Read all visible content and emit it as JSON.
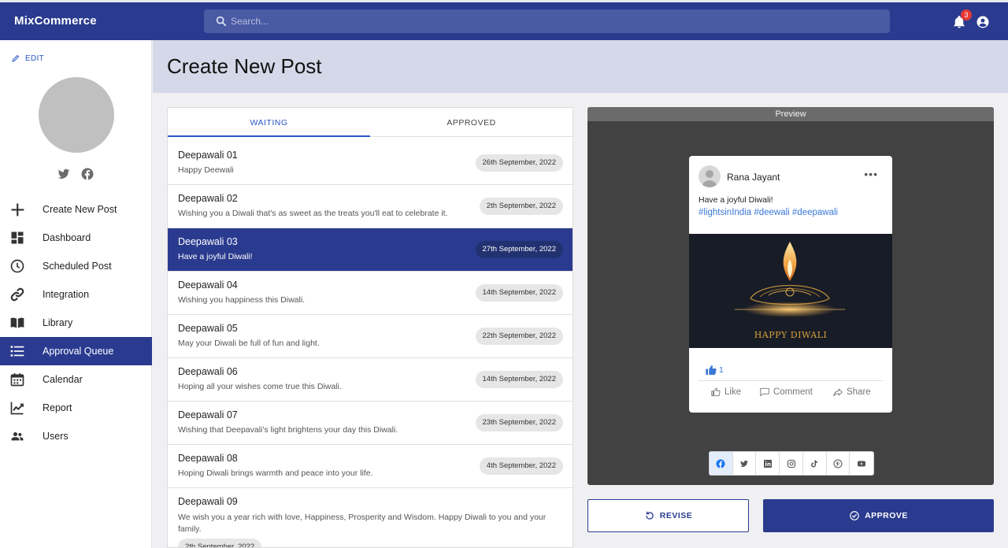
{
  "app": {
    "title": "MixCommerce"
  },
  "search": {
    "placeholder": "Search..."
  },
  "header": {
    "notification_count": "3"
  },
  "sidebar": {
    "edit_label": "EDIT",
    "items": [
      {
        "label": "Create New Post",
        "icon": "plus-icon"
      },
      {
        "label": "Dashboard",
        "icon": "dashboard-icon"
      },
      {
        "label": "Scheduled Post",
        "icon": "clock-icon"
      },
      {
        "label": "Integration",
        "icon": "link-icon"
      },
      {
        "label": "Library",
        "icon": "book-icon"
      },
      {
        "label": "Approval Queue",
        "icon": "list-icon",
        "active": true
      },
      {
        "label": "Calendar",
        "icon": "calendar-icon"
      },
      {
        "label": "Report",
        "icon": "chart-icon"
      },
      {
        "label": "Users",
        "icon": "users-icon"
      }
    ]
  },
  "page": {
    "title": "Create New Post"
  },
  "tabs": [
    {
      "label": "WAITING",
      "active": true
    },
    {
      "label": "APPROVED"
    }
  ],
  "posts": [
    {
      "title": "Deepawali 01",
      "text": "Happy Deewali",
      "date": "26th September, 2022"
    },
    {
      "title": "Deepawali 02",
      "text": "Wishing you a Diwali that's as sweet as the treats you'll eat to celebrate it.",
      "date": "2th September, 2022"
    },
    {
      "title": "Deepawali 03",
      "text": "Have a joyful Diwali!",
      "date": "27th September, 2022",
      "active": true
    },
    {
      "title": "Deepawali 04",
      "text": "Wishing you happiness this Diwali.",
      "date": "14th September, 2022"
    },
    {
      "title": "Deepawali 05",
      "text": "May your Diwali be full of fun and light.",
      "date": "22th September, 2022"
    },
    {
      "title": "Deepawali 06",
      "text": "Hoping all your wishes come true this Diwali.",
      "date": "14th September, 2022"
    },
    {
      "title": "Deepawali 07",
      "text": "Wishing that Deepavali's light brightens your day this Diwali.",
      "date": "23th September, 2022"
    },
    {
      "title": "Deepawali 08",
      "text": "Hoping Diwali brings warmth and peace into your life.",
      "date": "4th September, 2022"
    },
    {
      "title": "Deepawali 09",
      "text": "We wish you a year rich with love, Happiness, Prosperity and Wisdom. Happy Diwali to you and your family.",
      "date": "2th September, 2022"
    }
  ],
  "preview": {
    "header": "Preview",
    "author": "Rana Jayant",
    "text": "Have a joyful Diwali!",
    "hashtags": "#lightsinIndia #deewali #deepawali",
    "image_caption": "HAPPY DIWALI",
    "like_count": "1",
    "actions": {
      "like": "Like",
      "comment": "Comment",
      "share": "Share"
    },
    "platforms": [
      "facebook-icon",
      "twitter-icon",
      "linkedin-icon",
      "instagram-icon",
      "tiktok-icon",
      "pinterest-icon",
      "youtube-icon"
    ]
  },
  "buttons": {
    "revise": "REVISE",
    "approve": "APPROVE"
  },
  "colors": {
    "primary": "#2a3b8f",
    "accent": "#2a56c6",
    "badge": "#e53935",
    "title_bar": "#d5d8e8"
  }
}
